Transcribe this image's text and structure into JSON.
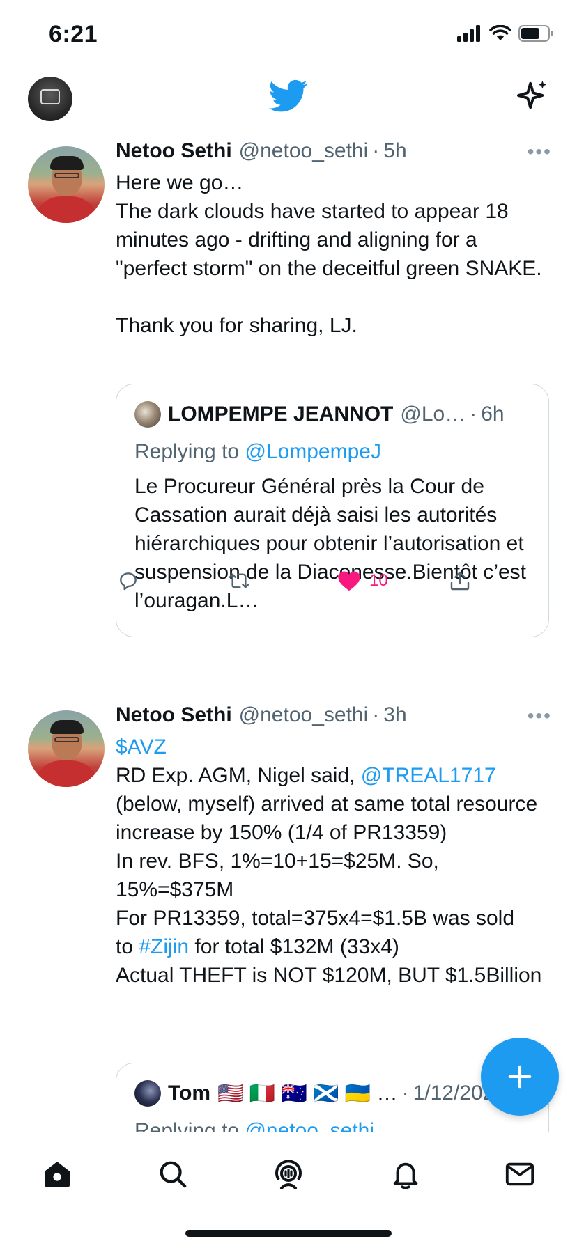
{
  "status_bar": {
    "time": "6:21"
  },
  "colors": {
    "accent": "#1d9bf0",
    "like": "#f91880",
    "text": "#0f1419",
    "secondary": "#536471"
  },
  "icons": {
    "signal": "cellular-signal-icon",
    "wifi": "wifi-icon",
    "battery": "battery-icon",
    "logo": "twitter-bird-icon",
    "sparkle": "sparkle-icon",
    "reply": "reply-icon",
    "retweet": "retweet-icon",
    "like": "heart-icon",
    "share": "share-icon",
    "compose": "plus-icon",
    "home": "home-icon",
    "search": "search-icon",
    "spaces": "spaces-icon",
    "notifications": "bell-icon",
    "messages": "mail-icon"
  },
  "tweets": [
    {
      "name": "Netoo Sethi",
      "handle": "@netoo_sethi",
      "dot": "·",
      "time": "5h",
      "text": "Here we go…\nThe dark clouds have started to appear 18 minutes ago - drifting and aligning for a \"perfect storm\" on the deceitful green SNAKE.\n\nThank you for sharing, LJ.",
      "quote": {
        "name": "LOMPEMPE JEANNOT",
        "handle": "@Lo…",
        "dot": "·",
        "time": "6h",
        "replying_prefix": "Replying to",
        "replying_to": "@LompempeJ",
        "text": "Le Procureur Général près la Cour de Cassation aurait déjà saisi les autorités hiérarchiques pour obtenir l’autorisation et suspension de la Diaconesse.Bientôt c’est l’ouragan.L…"
      },
      "like_count": "10",
      "liked": true
    },
    {
      "name": "Netoo Sethi",
      "handle": "@netoo_sethi",
      "dot": "·",
      "time": "3h",
      "cashtag": "$AVZ",
      "line1_prefix": "RD Exp. AGM, Nigel said,",
      "mention": "@TREAL1717",
      "text_mid": "(below, myself) arrived at same total resource increase by 150% (1/4 of PR13359)\nIn rev. BFS, 1%=10+15=$25M. So, 15%=$375M\nFor PR13359, total=375x4=$1.5B was sold",
      "to_word": "to",
      "hashtag": "#Zijin",
      "text_after_hashtag": "for total $132M (33x4)",
      "text_end": "Actual THEFT is NOT $120M, BUT $1.5Billion",
      "quote": {
        "name": "Tom",
        "flags": "🇺🇸 🇮🇹 🇦🇺 🏴󠁧󠁢󠁳󠁣󠁴󠁿 🇺🇦 …",
        "dot": "·",
        "time": "1/12/2022",
        "replying_prefix": "Replying to",
        "replying_to": "@netoo_sethi"
      }
    }
  ]
}
